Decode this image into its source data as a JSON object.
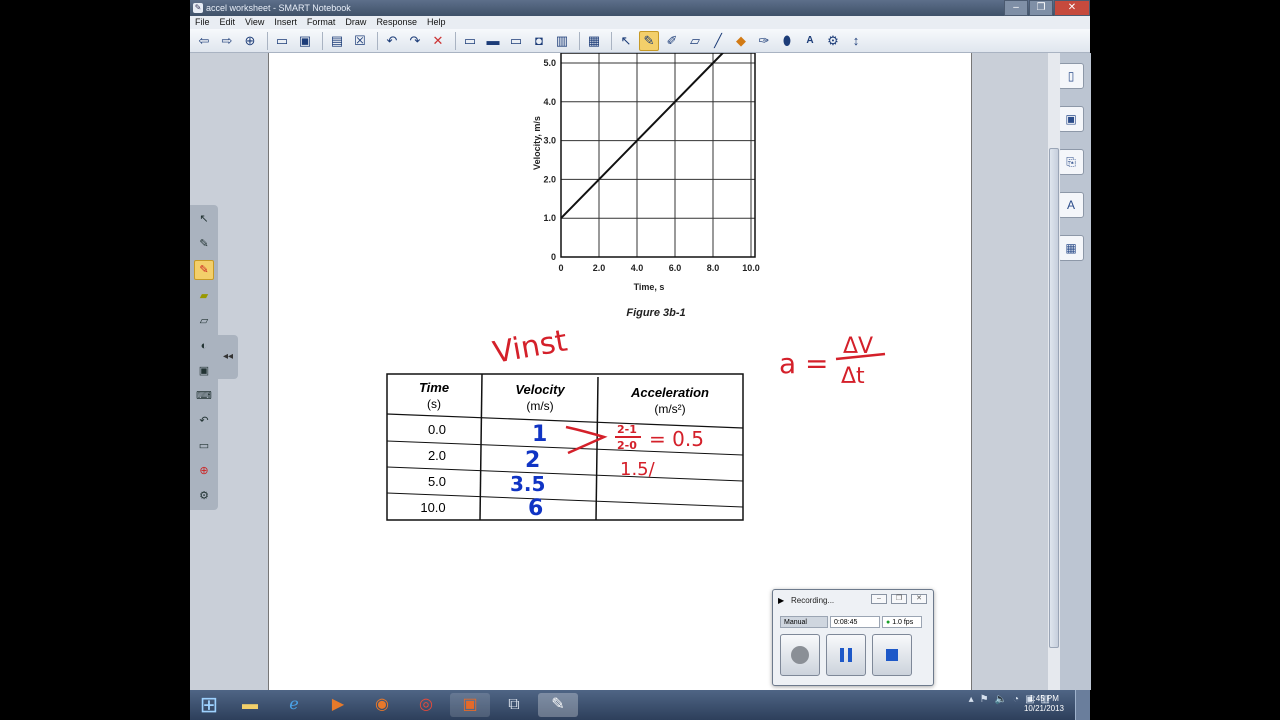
{
  "window": {
    "title": "accel worksheet - SMART Notebook",
    "buttons": [
      "‒",
      "❐",
      "✕"
    ]
  },
  "menu": [
    "File",
    "Edit",
    "View",
    "Insert",
    "Format",
    "Draw",
    "Response",
    "Help"
  ],
  "graph": {
    "xlabel": "Time, s",
    "ylabel": "Velocity, m/s",
    "x_ticks": [
      "0",
      "2.0",
      "4.0",
      "6.0",
      "8.0",
      "10.0"
    ],
    "y_ticks": [
      "0",
      "1.0",
      "2.0",
      "3.0",
      "4.0",
      "5.0"
    ],
    "caption": "Figure 3b-1"
  },
  "chart_data": {
    "type": "line",
    "xlabel": "Time, s",
    "ylabel": "Velocity, m/s",
    "xlim": [
      0,
      10
    ],
    "ylim": [
      0,
      5
    ],
    "grid": true,
    "x": [
      0,
      2,
      4,
      6,
      8,
      9.2
    ],
    "y": [
      1,
      2,
      3,
      4,
      5,
      5.6
    ],
    "caption": "Figure 3b-1"
  },
  "table": {
    "headers": [
      {
        "title": "Time",
        "unit": "(s)"
      },
      {
        "title": "Velocity",
        "unit": "(m/s)"
      },
      {
        "title": "Acceleration",
        "unit": "(m/s²)"
      }
    ],
    "rows": [
      {
        "time": "0.0",
        "velocity": "1",
        "acceleration": "2-1 / 2-0 = 0.5"
      },
      {
        "time": "2.0",
        "velocity": "2",
        "acceleration": "1.5/"
      },
      {
        "time": "5.0",
        "velocity": "3.5",
        "acceleration": ""
      },
      {
        "time": "10.0",
        "velocity": "6",
        "acceleration": ""
      }
    ]
  },
  "annotations": {
    "vinst": "Vinst",
    "formula_lhs": "a =",
    "formula_num": "ΔV",
    "formula_den": "Δt",
    "calc_num": "2-1",
    "calc_den": "2-0",
    "calc_result": "= 0.5",
    "partial": "1.5/"
  },
  "recorder": {
    "title": "Recording...",
    "mode": "Manual",
    "time": "0:08:45",
    "fps": "1.0 fps"
  },
  "taskbar": {
    "time": "1:45 PM",
    "date": "10/21/2013"
  },
  "colors": {
    "red_ink": "#d4202a",
    "blue_ink": "#1034c4",
    "highlight": "#f3cf6a"
  }
}
